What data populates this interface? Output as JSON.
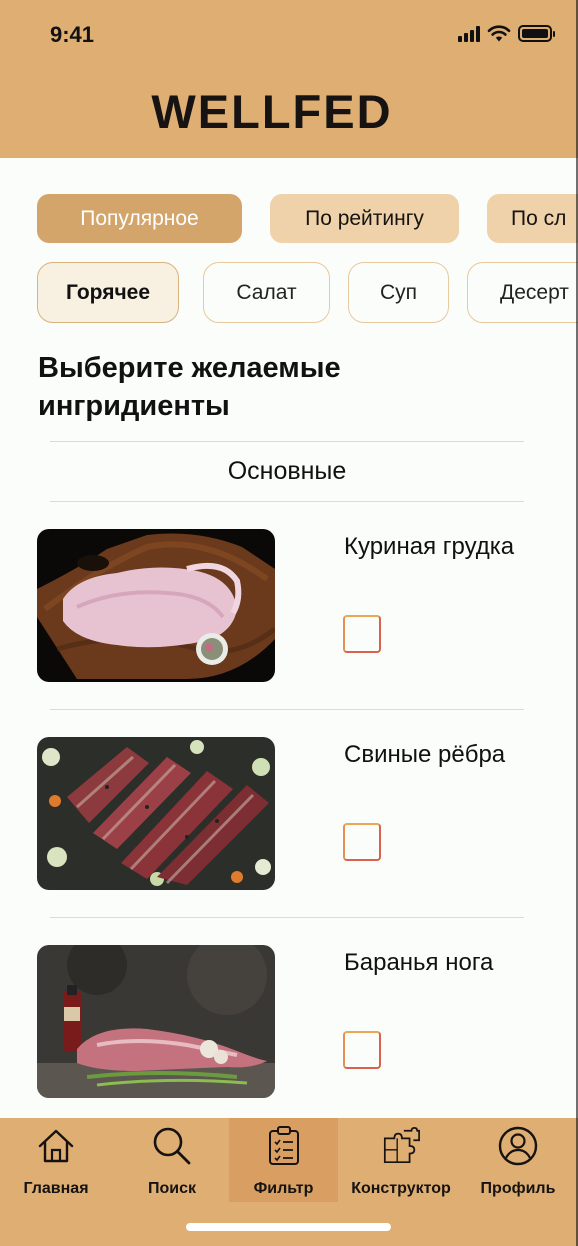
{
  "status_bar": {
    "time": "9:41",
    "icons": [
      "signal-icon",
      "wifi-icon",
      "battery-icon"
    ]
  },
  "header": {
    "title": "WELLFED",
    "background": "#deae72"
  },
  "sort_tabs": [
    {
      "label": "Популярное",
      "active": true
    },
    {
      "label": "По рейтингу",
      "active": false
    },
    {
      "label": "По сл",
      "active": false
    }
  ],
  "category_tabs": [
    {
      "label": "Горячее",
      "active": true
    },
    {
      "label": "Салат",
      "active": false
    },
    {
      "label": "Суп",
      "active": false
    },
    {
      "label": "Десерт",
      "active": false
    }
  ],
  "section": {
    "title": "Выберите желаемые ингридиенты",
    "group_title": "Основные"
  },
  "ingredients": [
    {
      "name": "Куриная грудка",
      "checked": false
    },
    {
      "name": "Свиные рёбра",
      "checked": false
    },
    {
      "name": "Баранья нога",
      "checked": false
    }
  ],
  "bottom_nav": {
    "items": [
      {
        "label": "Главная",
        "icon": "home-icon",
        "active": false
      },
      {
        "label": "Поиск",
        "icon": "search-icon",
        "active": false
      },
      {
        "label": "Фильтр",
        "icon": "clipboard-list-icon",
        "active": true
      },
      {
        "label": "Конструктор",
        "icon": "puzzle-icon",
        "active": false
      },
      {
        "label": "Профиль",
        "icon": "user-icon",
        "active": false
      }
    ]
  },
  "colors": {
    "accent": "#deae72",
    "chip_active": "#d4a56a",
    "chip": "#efd2a9",
    "checkbox": "#d9614d"
  }
}
